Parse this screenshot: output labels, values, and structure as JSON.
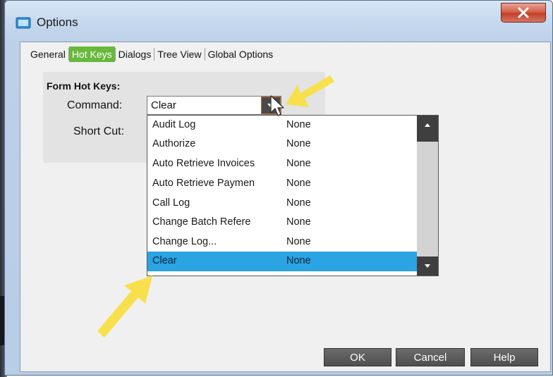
{
  "window": {
    "title": "Options"
  },
  "tabs": [
    {
      "label": "General",
      "active": false
    },
    {
      "label": "Hot Keys",
      "active": true
    },
    {
      "label": "Dialogs",
      "active": false
    },
    {
      "label": "Tree View",
      "active": false
    },
    {
      "label": "Global Options",
      "active": false
    }
  ],
  "form": {
    "group_label": "Form Hot Keys:",
    "command_label": "Command:",
    "command_value": "Clear",
    "shortcut_label": "Short Cut:"
  },
  "dropdown": {
    "items": [
      {
        "name": "Audit Log",
        "key": "None"
      },
      {
        "name": "Authorize",
        "key": "None"
      },
      {
        "name": "Auto Retrieve Invoices",
        "key": "None"
      },
      {
        "name": "Auto Retrieve Paymen",
        "key": "None"
      },
      {
        "name": "Call Log",
        "key": "None"
      },
      {
        "name": "Change Batch Refere",
        "key": "None"
      },
      {
        "name": "Change Log...",
        "key": "None"
      },
      {
        "name": "Clear",
        "key": "None",
        "selected": true
      }
    ]
  },
  "buttons": {
    "ok": "OK",
    "cancel": "Cancel",
    "help": "Help"
  },
  "icons": {
    "app": "window-icon",
    "close": "close-x-icon",
    "combo_arrow": "chevron-down-icon",
    "scroll_up": "triangle-up-icon",
    "scroll_down": "triangle-down-icon",
    "annotation": "yellow-arrow-icon"
  },
  "colors": {
    "active_tab": "#67b83b",
    "selection": "#2aa4e2",
    "close_button": "#d6614a",
    "annotation_arrow": "#f7e04c"
  }
}
